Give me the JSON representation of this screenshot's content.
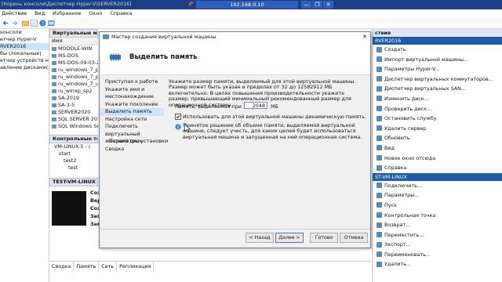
{
  "rdp": {
    "address": "192.168.0.10",
    "pin": "📌",
    "minimize": "—",
    "restore": "❐",
    "close": "✕"
  },
  "window": {
    "title": "[Корень консоли\\Диспетчер Hyper-V\\SERVER2016]"
  },
  "menu": [
    "Действие",
    "Вид",
    "Избранное",
    "Окно",
    "Справка"
  ],
  "tree": [
    "консоли",
    "етчер Hyper-V",
    "RVER2016",
    "бы (локальные)",
    "етчер устройств на л",
    "авление дисками(Лок)"
  ],
  "vm_panel": {
    "header": "Виртуальные машины",
    "col": "Имя",
    "items": [
      "MOODLE-WIN",
      "MS-DOS",
      "MS-DOS-09-03-2020",
      "ru_windows_7_profe",
      "ru_windows_7_profe",
      "ru_windows_7_ultima",
      "ru_winxp_sp2",
      "SA-2019",
      "SA-3-5",
      "SERVER2020",
      "SQL SERVER 2019",
      "SQL Windows Server"
    ]
  },
  "checkpoints": {
    "header": "Контрольные точки",
    "items": [
      "VM-LINUX-5 - (",
      "start",
      "test2",
      "test"
    ]
  },
  "details": {
    "header": "TEST-VM-LINUX",
    "lines": [
      "Созд",
      "Вер",
      "Созд",
      "Запу",
      "Зам"
    ]
  },
  "bottom_tabs": [
    "Сводка",
    "Память",
    "Сеть",
    "Репликация"
  ],
  "actions": {
    "header": "ствия",
    "server": "RVER2016",
    "server_items": [
      "Создать",
      "Импорт виртуальной машины...",
      "Параметры Hyper-V...",
      "Диспетчер виртуальных коммутаторов...",
      "Диспетчер виртуальных SAN...",
      "Изменить диск...",
      "Проверить диск...",
      "Остановить службу",
      "Удалить сервер",
      "Обновить",
      "Вид",
      "Новое окно отсюда",
      "Справка"
    ],
    "vm": "ST-VM-LINUX",
    "vm_items": [
      "Подключить...",
      "Параметры...",
      "Пуск",
      "Контрольная точка",
      "Возврат...",
      "Переместить...",
      "Экспорт...",
      "Переименовать...",
      "Удалить..."
    ]
  },
  "dialog": {
    "title": "Мастер создания виртуальной машины",
    "heading": "Выделить память",
    "steps": [
      "Приступая к работе",
      "Укажите имя и местонахождение",
      "Укажите поколение",
      "Выделить память",
      "Настройка сети",
      "Подключить виртуальный жесткий диск",
      "Параметры установки",
      "Сводка"
    ],
    "description": "Укажите размер памяти, выделяемый для этой виртуальной машины. Размер может быть указан в пределах от 32 до 12582912 МБ включительно. В целях повышения производительности укажите размер, превышающий минимальный рекомендованный размер для операционной системы.",
    "memory_label": "Память, выделяемая при запуске:",
    "memory_value": "2048",
    "memory_unit": "МБ",
    "dynamic_label": "Использовать для этой виртуальной машины динамическую память.",
    "note": "Принятое решение об объеме памяти, выделяемой виртуальной машине, следует учесть, для каких целей будет использоваться виртуальная машина и запущенная на ней операционная система.",
    "btn_back": "< Назад",
    "btn_next": "Далее >",
    "btn_finish": "Готово",
    "btn_cancel": "Отмена",
    "close": "✕"
  },
  "colors": {
    "rdp_bar": "#1c3f8a",
    "selection": "#cfe3f7",
    "action_section": "#1f5aa6"
  }
}
